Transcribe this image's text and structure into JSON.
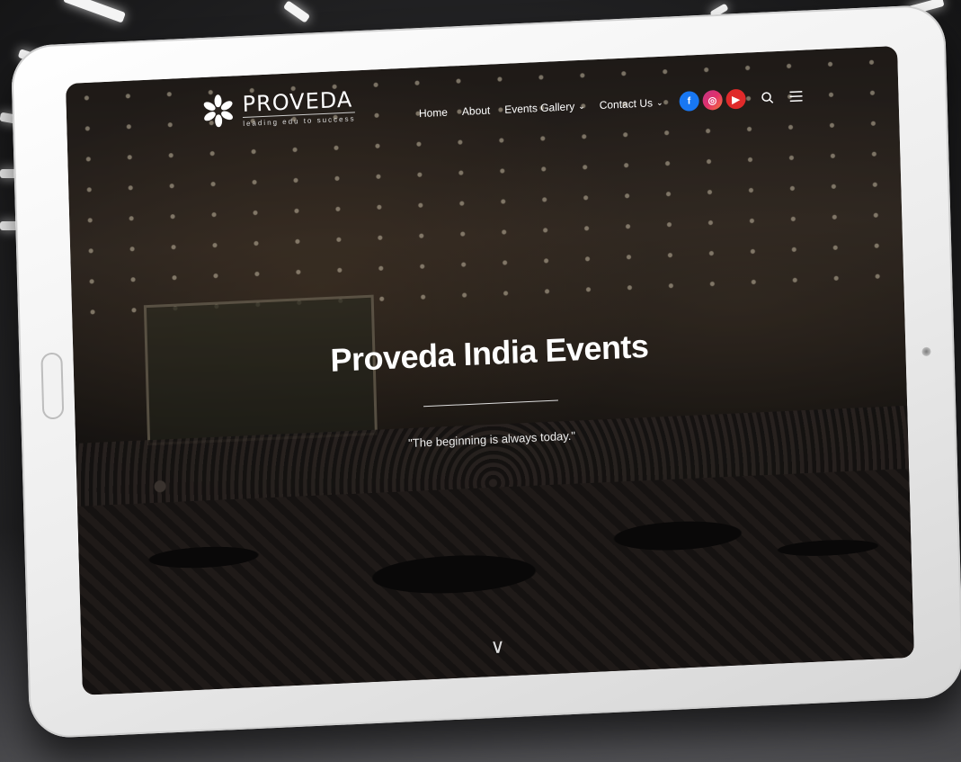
{
  "site": {
    "brand_name": "PROVEDA",
    "brand_tagline": "leading edu to success"
  },
  "nav": {
    "items": [
      {
        "label": "Home",
        "has_dropdown": false
      },
      {
        "label": "About",
        "has_dropdown": false
      },
      {
        "label": "Events Gallery",
        "has_dropdown": true
      },
      {
        "label": "Contact Us",
        "has_dropdown": true
      }
    ],
    "social": [
      {
        "icon": "facebook-icon",
        "glyph": "f",
        "color": "#1877f2"
      },
      {
        "icon": "instagram-icon",
        "glyph": "◎",
        "color": "#e1306c"
      },
      {
        "icon": "youtube-icon",
        "glyph": "▶",
        "color": "#e02a2a"
      }
    ],
    "search_glyph": "⌕",
    "menu_glyph": "☰"
  },
  "hero": {
    "title": "Proveda India Events",
    "quote": "\"The beginning is always today.\"",
    "scroll_glyph": "∨"
  },
  "colors": {
    "facebook": "#1877f2",
    "instagram": "#e1306c",
    "youtube": "#e02a2a"
  }
}
